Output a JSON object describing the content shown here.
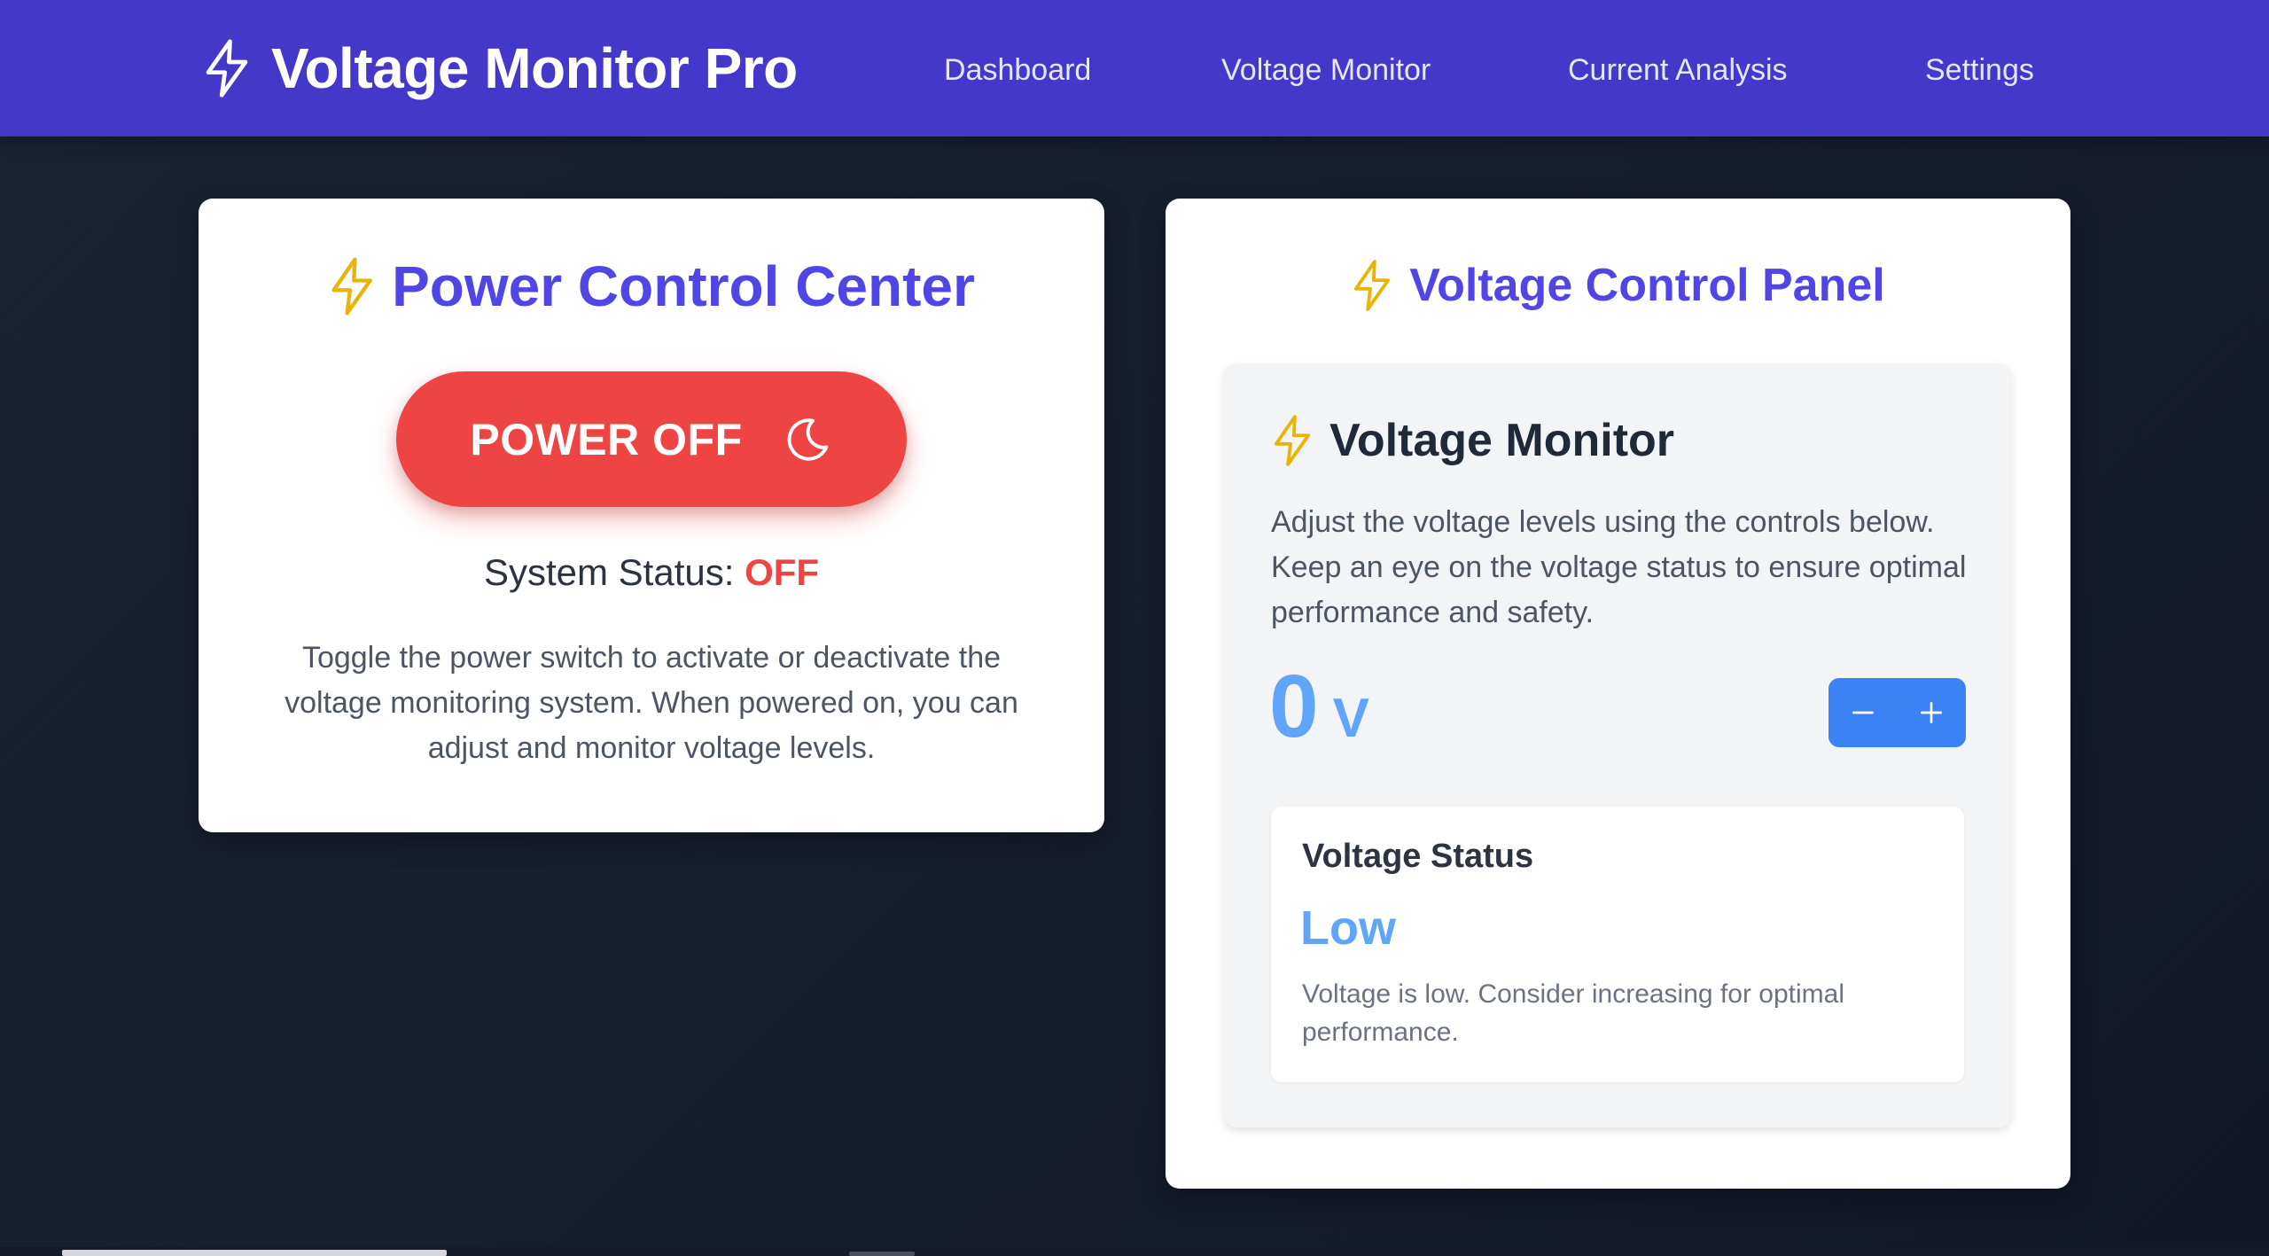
{
  "header": {
    "brand_title": "Voltage Monitor Pro",
    "brand_icon": "lightning-bolt-icon",
    "nav": [
      "Dashboard",
      "Voltage Monitor",
      "Current Analysis",
      "Settings"
    ]
  },
  "power_card": {
    "title": "Power Control Center",
    "title_icon": "lightning-bolt-icon",
    "button_label": "POWER OFF",
    "button_icon": "moon-icon",
    "status_label": "System Status:",
    "status_value": "OFF",
    "description": "Toggle the power switch to activate or deactivate the voltage monitoring system. When powered on, you can adjust and monitor voltage levels."
  },
  "voltage_panel": {
    "title": "Voltage Control Panel",
    "title_icon": "lightning-bolt-icon",
    "monitor": {
      "title": "Voltage Monitor",
      "description": "Adjust the voltage levels using the controls below. Keep an eye on the voltage status to ensure optimal performance and safety.",
      "value": "0",
      "unit": "V",
      "decrease_label": "−",
      "increase_label": "+"
    },
    "status": {
      "title": "Voltage Status",
      "value": "Low",
      "note": "Voltage is low. Consider increasing for optimal performance."
    }
  },
  "colors": {
    "header_bg": "#4338ca",
    "accent": "#4f46e5",
    "power_off": "#ef4444",
    "bolt": "#eab308",
    "voltage_blue": "#60a5fa",
    "stepper_blue": "#3b82f6",
    "background": "#1a2230"
  }
}
